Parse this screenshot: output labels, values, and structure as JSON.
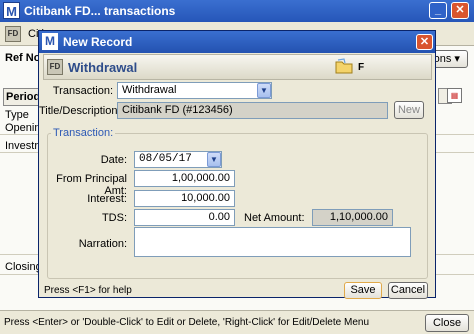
{
  "app": {
    "title": "Citibank FD... transactions",
    "logo": "M",
    "fd_badge": "FD",
    "crumb": "Citi",
    "options_label": "tions",
    "ref_label": "Ref No",
    "col_period": "Period",
    "rows": [
      "Type",
      "Openin",
      "Investr"
    ],
    "closing_label": "Closing",
    "close_button": "Close",
    "status_text": "Press <Enter> or 'Double-Click' to Edit or Delete, 'Right-Click' for Edit/Delete Menu"
  },
  "dialog": {
    "title": "New Record",
    "logo": "M",
    "header": {
      "badge": "FD",
      "type_label": "Withdrawal",
      "flag": "F"
    },
    "transaction_label": "Transaction:",
    "transaction_value": "Withdrawal",
    "title_label": "Title/Description:",
    "title_value": "Citibank FD (#123456)",
    "new_button": "New",
    "group_label": "Transaction:",
    "date_label": "Date:",
    "date_value": "08/05/17",
    "principal_label": "From Principal Amt:",
    "principal_value": "1,00,000.00",
    "interest_label": "Interest:",
    "interest_value": "10,000.00",
    "tds_label": "TDS:",
    "tds_value": "0.00",
    "net_label": "Net Amount:",
    "net_value": "1,10,000.00",
    "narration_label": "Narration:",
    "narration_value": "",
    "help_text": "Press  <F1> for help",
    "save_button": "Save",
    "cancel_button": "Cancel"
  },
  "icons": [
    "app-logo-icon",
    "minimize-icon",
    "close-icon",
    "dropdown-arrow-icon",
    "folder-icon",
    "calendar-icon"
  ],
  "colors": {
    "titlebar": "#2a5bc2",
    "dialog_bg": "#ece9d8",
    "close_red": "#d9552f",
    "accent_blue": "#2d59b5"
  }
}
